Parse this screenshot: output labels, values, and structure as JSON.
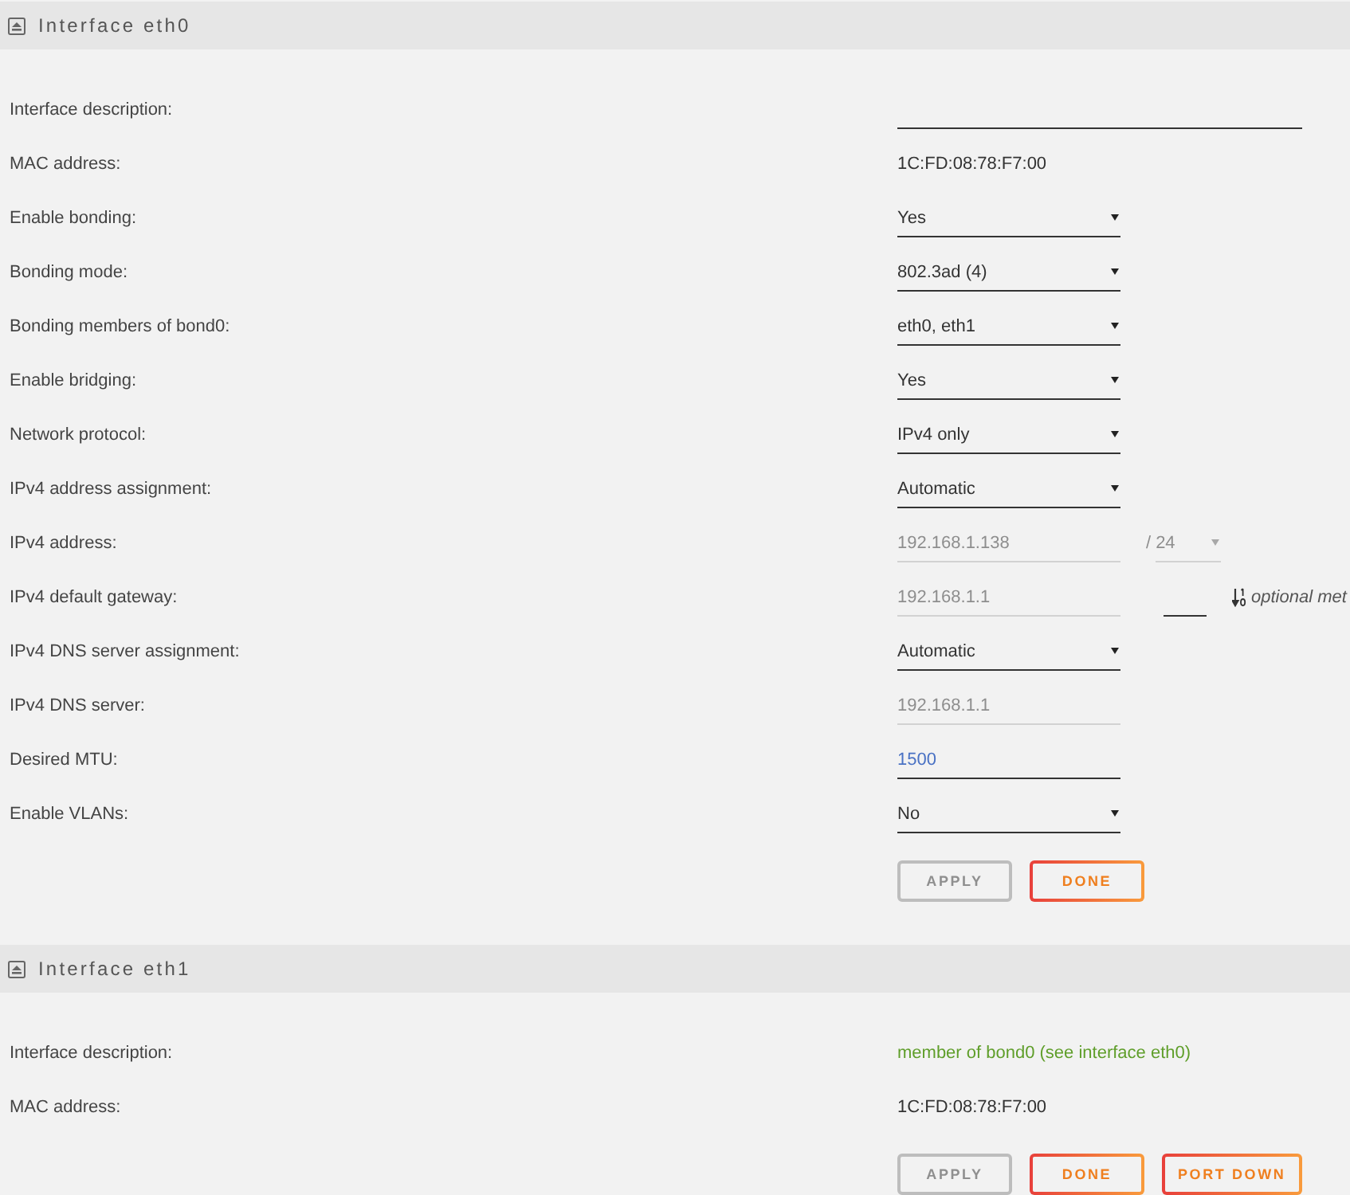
{
  "sections": [
    {
      "title": "Interface eth0",
      "rows": [
        {
          "label": "Interface description:",
          "kind": "long-input",
          "disabled": false
        },
        {
          "label": "MAC address:",
          "kind": "text",
          "value": "1C:FD:08:78:F7:00"
        },
        {
          "label": "Enable bonding:",
          "kind": "select",
          "value": "Yes",
          "disabled": false
        },
        {
          "label": "Bonding mode:",
          "kind": "select",
          "value": "802.3ad (4)",
          "disabled": false
        },
        {
          "label": "Bonding members of bond0:",
          "kind": "select",
          "value": "eth0, eth1",
          "disabled": false
        },
        {
          "label": "Enable bridging:",
          "kind": "select",
          "value": "Yes",
          "disabled": false
        },
        {
          "label": "Network protocol:",
          "kind": "select",
          "value": "IPv4 only",
          "disabled": false
        },
        {
          "label": "IPv4 address assignment:",
          "kind": "select",
          "value": "Automatic",
          "disabled": false
        },
        {
          "label": "IPv4 address:",
          "kind": "input",
          "value": "192.168.1.138",
          "disabled": true,
          "prefix": {
            "separator": "/",
            "value": "24",
            "disabled": true
          }
        },
        {
          "label": "IPv4 default gateway:",
          "kind": "input",
          "value": "192.168.1.1",
          "disabled": true,
          "metric": {
            "hint": "optional met"
          }
        },
        {
          "label": "IPv4 DNS server assignment:",
          "kind": "select",
          "value": "Automatic",
          "disabled": false
        },
        {
          "label": "IPv4 DNS server:",
          "kind": "input",
          "value": "192.168.1.1",
          "disabled": true
        },
        {
          "label": "Desired MTU:",
          "kind": "input",
          "value": "1500",
          "disabled": false
        },
        {
          "label": "Enable VLANs:",
          "kind": "select",
          "value": "No",
          "disabled": false
        }
      ],
      "buttons": [
        {
          "label": "APPLY",
          "disabled": true
        },
        {
          "label": "DONE",
          "disabled": false
        }
      ]
    },
    {
      "title": "Interface eth1",
      "rows": [
        {
          "label": "Interface description:",
          "kind": "note",
          "value": "member of bond0 (see interface eth0)"
        },
        {
          "label": "MAC address:",
          "kind": "text",
          "value": "1C:FD:08:78:F7:00"
        }
      ],
      "buttons": [
        {
          "label": "APPLY",
          "disabled": true
        },
        {
          "label": "DONE",
          "disabled": false
        },
        {
          "label": "PORT DOWN",
          "disabled": false
        }
      ]
    }
  ]
}
